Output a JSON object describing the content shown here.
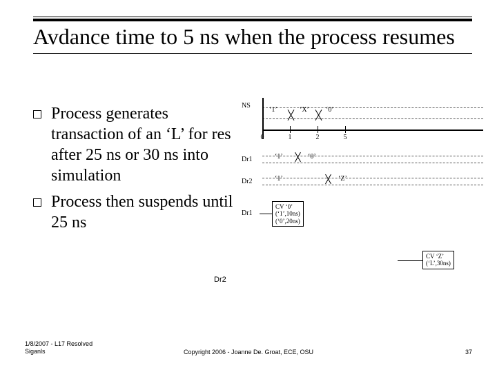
{
  "title": "Avdance time to 5 ns when the process resumes",
  "bullets": [
    "Process generates transaction of an ‘L’ for res after 25 ns or 30 ns into simulation",
    "Process then suspends until 25 ns"
  ],
  "timeline": {
    "signal": "NS",
    "ticks": [
      "0",
      "1",
      "2",
      "5"
    ],
    "vals": [
      "‘1’",
      "‘X’",
      "‘0’"
    ]
  },
  "dr1": {
    "label": "Dr1",
    "vals": [
      "‘1’",
      "‘0’"
    ]
  },
  "dr2": {
    "label": "Dr2",
    "vals": [
      "‘1’",
      "‘Z’"
    ]
  },
  "box1": {
    "label": "Dr1",
    "lines": [
      "CV   ‘0’",
      "(‘1’,10ns)",
      "(‘0’,20ns)"
    ]
  },
  "box2": {
    "label": "Dr2",
    "lines": [
      "CV   ‘Z’",
      "(‘L’,30ns)"
    ]
  },
  "footer_left_1": "1/8/2007 - L17 Resolved",
  "footer_left_2": "Siganls",
  "footer_center": "Copyright 2006 - Joanne De. Groat, ECE, OSU",
  "footer_right": "37"
}
